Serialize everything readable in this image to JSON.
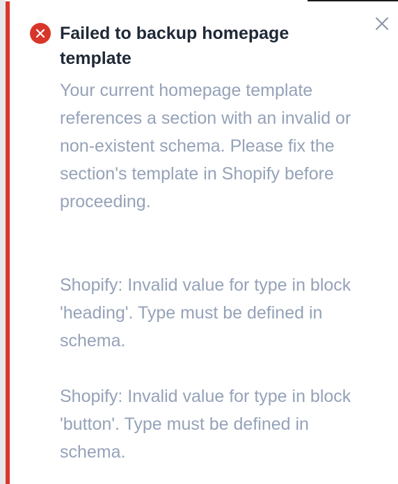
{
  "toast": {
    "status": "error",
    "accent_color": "#d9362b",
    "icon": "error-x-circle-icon",
    "close_icon": "close-icon",
    "title": "Failed to backup homepage template",
    "messages": [
      "Your current homepage template references a section with an invalid or non-existent schema. Please fix the section's template in Shopify before proceeding.",
      "Shopify: Invalid value for type in block 'heading'. Type must be defined in schema.",
      "Shopify: Invalid value for type in block 'button'. Type must be defined in schema."
    ]
  }
}
